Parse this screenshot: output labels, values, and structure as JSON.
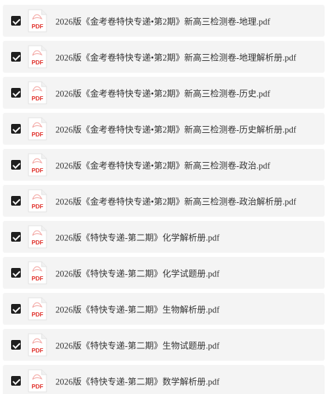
{
  "file_list": {
    "icon_label": "PDF",
    "items": [
      {
        "checked": true,
        "name": "2026版《金考卷特快专递•第2期》新高三检测卷-地理.pdf"
      },
      {
        "checked": true,
        "name": "2026版《金考卷特快专递•第2期》新高三检测卷-地理解析册.pdf"
      },
      {
        "checked": true,
        "name": "2026版《金考卷特快专递•第2期》新高三检测卷-历史.pdf"
      },
      {
        "checked": true,
        "name": "2026版《金考卷特快专递•第2期》新高三检测卷-历史解析册.pdf"
      },
      {
        "checked": true,
        "name": "2026版《金考卷特快专递•第2期》新高三检测卷-政治.pdf"
      },
      {
        "checked": true,
        "name": "2026版《金考卷特快专递•第2期》新高三检测卷-政治解析册.pdf"
      },
      {
        "checked": true,
        "name": "2026版《特快专递-第二期》化学解析册.pdf"
      },
      {
        "checked": true,
        "name": "2026版《特快专递-第二期》化学试题册.pdf"
      },
      {
        "checked": true,
        "name": "2026版《特快专递-第二期》生物解析册.pdf"
      },
      {
        "checked": true,
        "name": "2026版《特快专递-第二期》生物试题册.pdf"
      },
      {
        "checked": true,
        "name": "2026版《特快专递-第二期》数学解析册.pdf"
      }
    ]
  }
}
